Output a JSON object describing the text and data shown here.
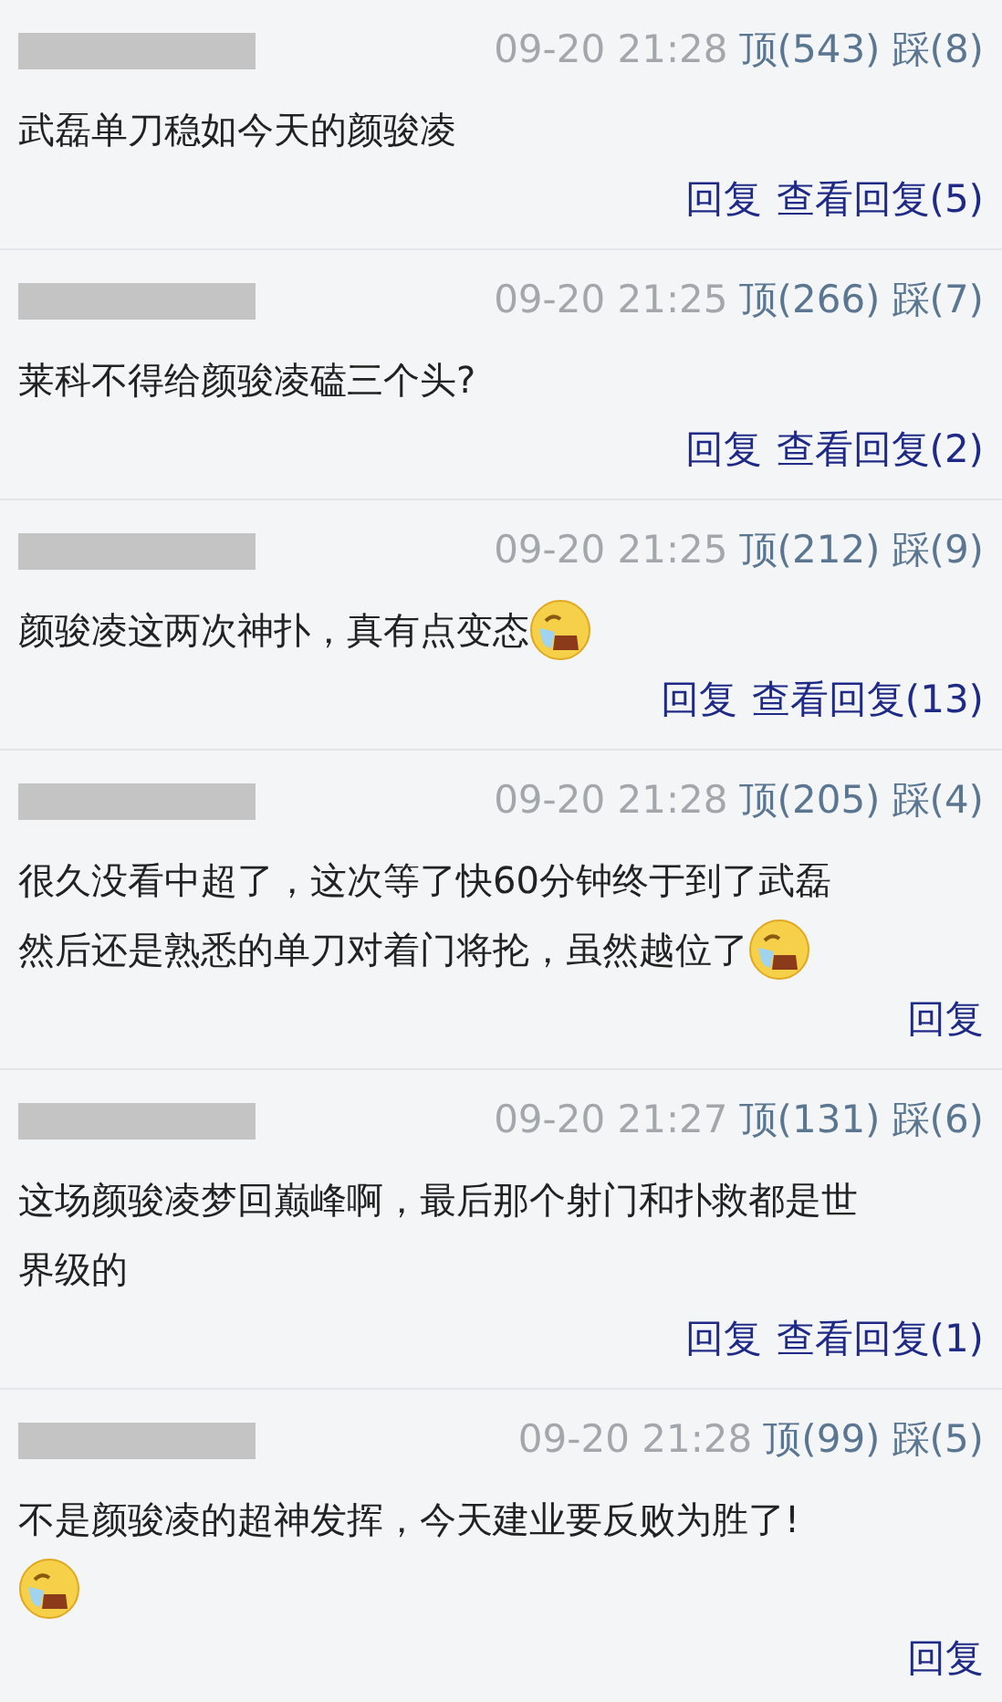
{
  "comments": [
    {
      "time": "09-20 21:28",
      "up": "顶(543)",
      "down": "踩(8)",
      "lines": [
        {
          "text": "武磊单刀稳如今天的颜骏凌"
        }
      ],
      "actions": [
        "回复",
        "查看回复(5)"
      ]
    },
    {
      "time": "09-20 21:25",
      "up": "顶(266)",
      "down": "踩(7)",
      "lines": [
        {
          "text": "莱科不得给颜骏凌磕三个头?"
        }
      ],
      "actions": [
        "回复",
        "查看回复(2)"
      ]
    },
    {
      "time": "09-20 21:25",
      "up": "顶(212)",
      "down": "踩(9)",
      "lines": [
        {
          "text": "颜骏凌这两次神扑，真有点变态",
          "emoji": true
        }
      ],
      "actions": [
        "回复",
        "查看回复(13)"
      ]
    },
    {
      "time": "09-20 21:28",
      "up": "顶(205)",
      "down": "踩(4)",
      "lines": [
        {
          "text": "很久没看中超了，这次等了快60分钟终于到了武磊"
        },
        {
          "text": "然后还是熟悉的单刀对着门将抡，虽然越位了",
          "emoji": true
        }
      ],
      "actions": [
        "回复"
      ]
    },
    {
      "time": "09-20 21:27",
      "up": "顶(131)",
      "down": "踩(6)",
      "lines": [
        {
          "text": "这场颜骏凌梦回巅峰啊，最后那个射门和扑救都是世"
        },
        {
          "text": "界级的"
        }
      ],
      "actions": [
        "回复",
        "查看回复(1)"
      ]
    },
    {
      "time": "09-20 21:28",
      "up": "顶(99)",
      "down": "踩(5)",
      "lines": [
        {
          "text": "不是颜骏凌的超神发挥，今天建业要反败为胜了!"
        },
        {
          "emoji": true
        }
      ],
      "actions": [
        "回复"
      ]
    }
  ]
}
